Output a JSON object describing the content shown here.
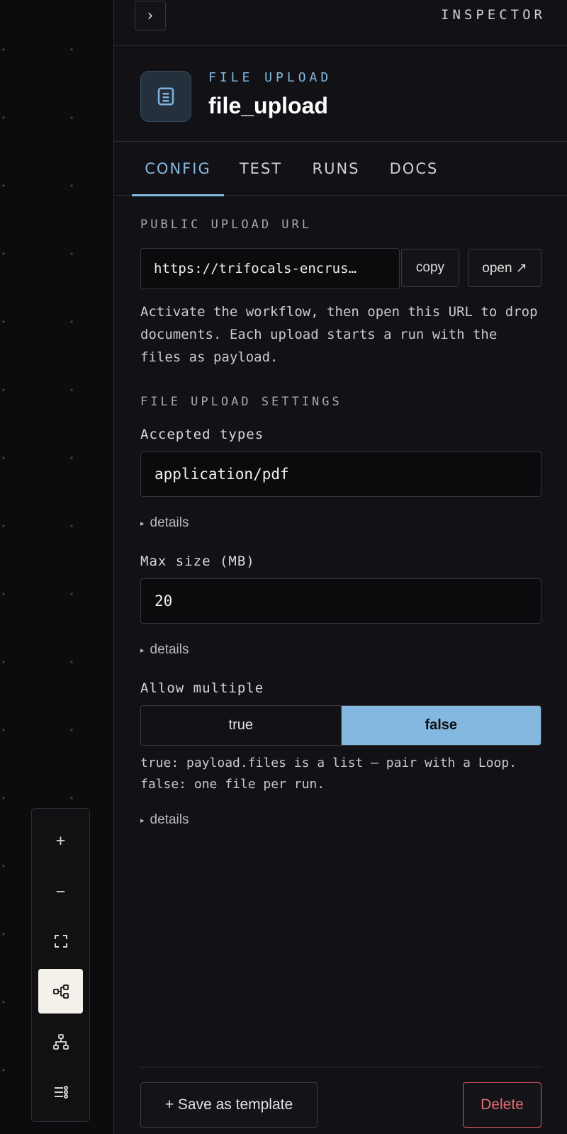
{
  "inspector": {
    "title": "INSPECTOR",
    "collapse_glyph": "›"
  },
  "node": {
    "type_label": "FILE UPLOAD",
    "name": "file_upload",
    "icon": "document-icon"
  },
  "tabs": [
    {
      "label": "CONFIG",
      "active": true
    },
    {
      "label": "TEST",
      "active": false
    },
    {
      "label": "RUNS",
      "active": false
    },
    {
      "label": "DOCS",
      "active": false
    }
  ],
  "public_url": {
    "section_label": "PUBLIC UPLOAD URL",
    "value": "https://trifocals-encrus…",
    "copy_label": "copy",
    "open_label": "open ↗",
    "help": "Activate the workflow, then open this URL to drop documents. Each upload starts a run with the files as payload."
  },
  "settings": {
    "section_label": "FILE UPLOAD SETTINGS",
    "accepted_types": {
      "label": "Accepted types",
      "value": "application/pdf",
      "details_label": "details"
    },
    "max_size": {
      "label": "Max size (MB)",
      "value": "20",
      "details_label": "details"
    },
    "allow_multiple": {
      "label": "Allow multiple",
      "options": [
        "true",
        "false"
      ],
      "selected": "false",
      "help": "true: payload.files is a list — pair with a Loop. false: one file per run.",
      "details_label": "details"
    }
  },
  "footer": {
    "save_label": "+ Save as template",
    "delete_label": "Delete"
  },
  "canvas_toolbar": {
    "zoom_in_glyph": "+",
    "zoom_out_glyph": "−",
    "tools": [
      "zoom-in-icon",
      "zoom-out-icon",
      "fit-view-icon",
      "flow-layout-icon",
      "tree-layout-icon",
      "list-icon"
    ],
    "active_tool": "flow-layout-icon"
  },
  "colors": {
    "accent": "#83b8e0",
    "danger": "#e56a70",
    "panel_bg": "#121216"
  }
}
